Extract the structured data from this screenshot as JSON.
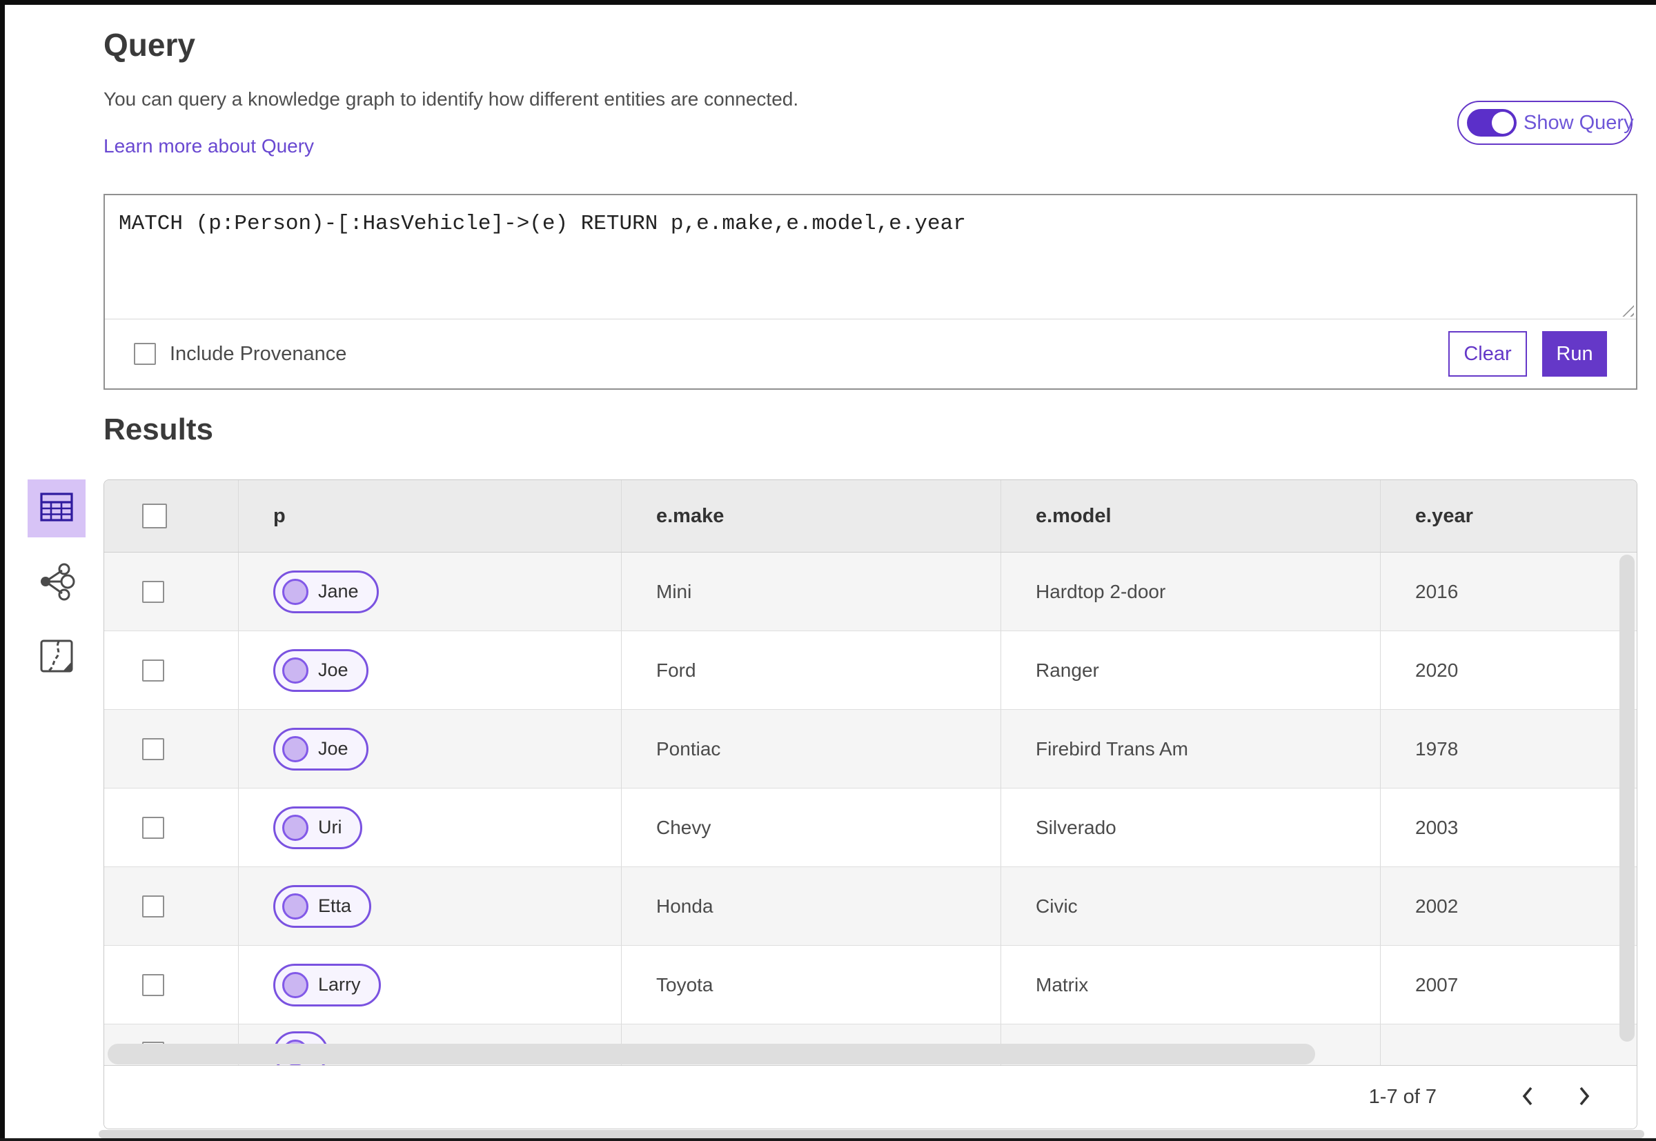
{
  "query": {
    "title": "Query",
    "description": "You can query a knowledge graph to identify how different entities are connected.",
    "learn_more_label": "Learn more about Query",
    "show_query_label": "Show Query",
    "show_query_on": true,
    "text": "MATCH (p:Person)-[:HasVehicle]->(e) RETURN p,e.make,e.model,e.year",
    "include_provenance_label": "Include Provenance",
    "include_provenance_checked": false,
    "clear_label": "Clear",
    "run_label": "Run"
  },
  "results": {
    "title": "Results",
    "views": [
      {
        "name": "table-view-icon",
        "selected": true
      },
      {
        "name": "link-chart-view-icon",
        "selected": false
      },
      {
        "name": "map-view-icon",
        "selected": false
      }
    ],
    "table": {
      "columns": [
        "p",
        "e.make",
        "e.model",
        "e.year"
      ],
      "rows": [
        {
          "p": "Jane",
          "e_make": "Mini",
          "e_model": "Hardtop 2-door",
          "e_year": "2016"
        },
        {
          "p": "Joe",
          "e_make": "Ford",
          "e_model": "Ranger",
          "e_year": "2020"
        },
        {
          "p": "Joe",
          "e_make": "Pontiac",
          "e_model": "Firebird Trans Am",
          "e_year": "1978"
        },
        {
          "p": "Uri",
          "e_make": "Chevy",
          "e_model": "Silverado",
          "e_year": "2003"
        },
        {
          "p": "Etta",
          "e_make": "Honda",
          "e_model": "Civic",
          "e_year": "2002"
        },
        {
          "p": "Larry",
          "e_make": "Toyota",
          "e_model": "Matrix",
          "e_year": "2007"
        }
      ],
      "pagination": {
        "range_label": "1-7 of 7",
        "icons": [
          "chevron-left-icon",
          "chevron-right-icon"
        ]
      }
    }
  },
  "colors": {
    "accent": "#6538c8",
    "toggle_track": "#5b2fc9",
    "selected_view_bg": "#d7c3f6",
    "chip_border": "#7a52e0",
    "chip_fill": "#f7f4fe",
    "chip_circle": "#cbb6f2",
    "header_bg": "#ebebeb",
    "alt_row_bg": "#f5f5f5"
  }
}
